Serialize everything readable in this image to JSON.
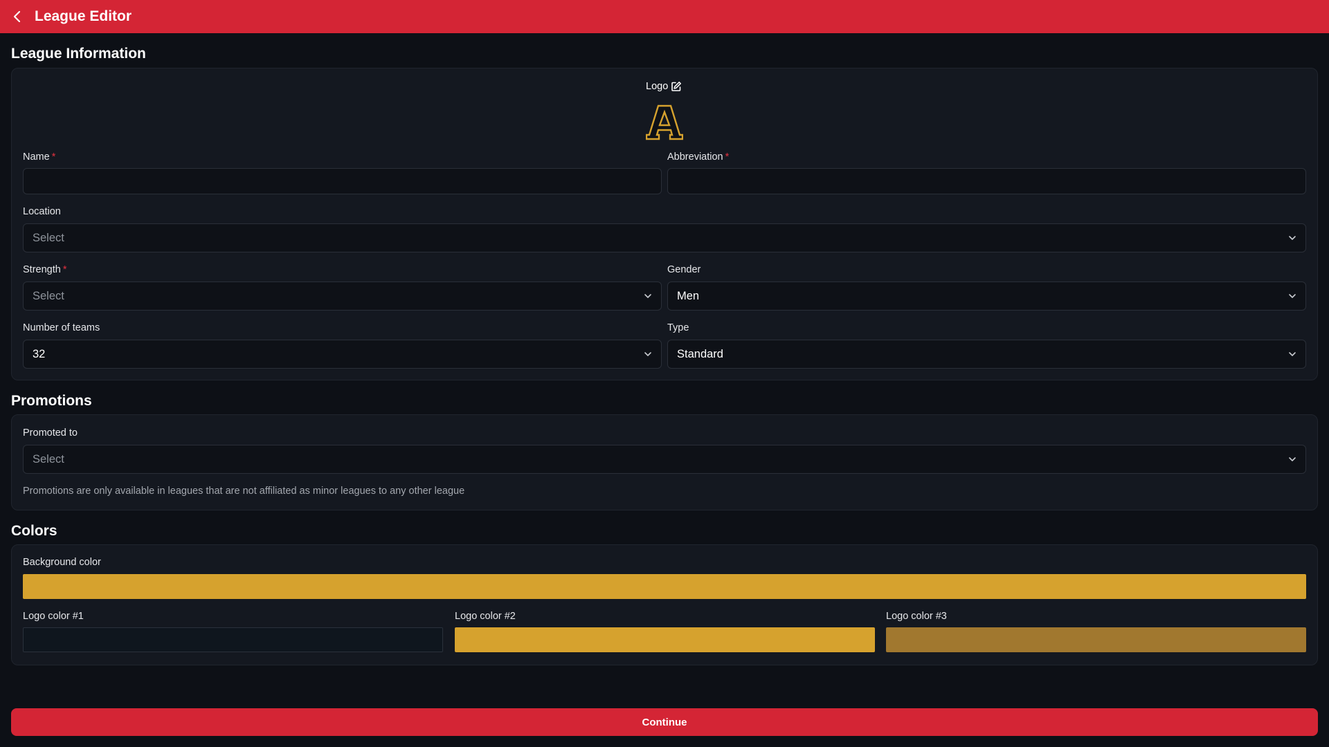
{
  "header": {
    "title": "League Editor",
    "back_icon": "chevron-left-icon"
  },
  "league_info": {
    "section_title": "League Information",
    "logo_label": "Logo",
    "logo_letter": "A",
    "logo_colors": {
      "fill": "#0e1117",
      "stroke": "#d6a22e"
    },
    "name": {
      "label": "Name",
      "required": "*",
      "value": ""
    },
    "abbreviation": {
      "label": "Abbreviation",
      "required": "*",
      "value": ""
    },
    "location": {
      "label": "Location",
      "placeholder": "Select"
    },
    "strength": {
      "label": "Strength",
      "required": "*",
      "placeholder": "Select"
    },
    "gender": {
      "label": "Gender",
      "value": "Men"
    },
    "number_of_teams": {
      "label": "Number of teams",
      "value": "32"
    },
    "type": {
      "label": "Type",
      "value": "Standard"
    }
  },
  "promotions": {
    "section_title": "Promotions",
    "promoted_to": {
      "label": "Promoted to",
      "placeholder": "Select"
    },
    "hint": "Promotions are only available in leagues that are not affiliated as minor leagues to any other league"
  },
  "colors": {
    "section_title": "Colors",
    "background": {
      "label": "Background color",
      "color": "#d6a22e"
    },
    "logo1": {
      "label": "Logo color #1",
      "color": "#0f161e"
    },
    "logo2": {
      "label": "Logo color #2",
      "color": "#d6a22e"
    },
    "logo3": {
      "label": "Logo color #3",
      "color": "#a1782f"
    }
  },
  "footer": {
    "continue_label": "Continue"
  },
  "theme": {
    "accent": "#d42535",
    "background": "#0d1016",
    "card": "#141820"
  }
}
